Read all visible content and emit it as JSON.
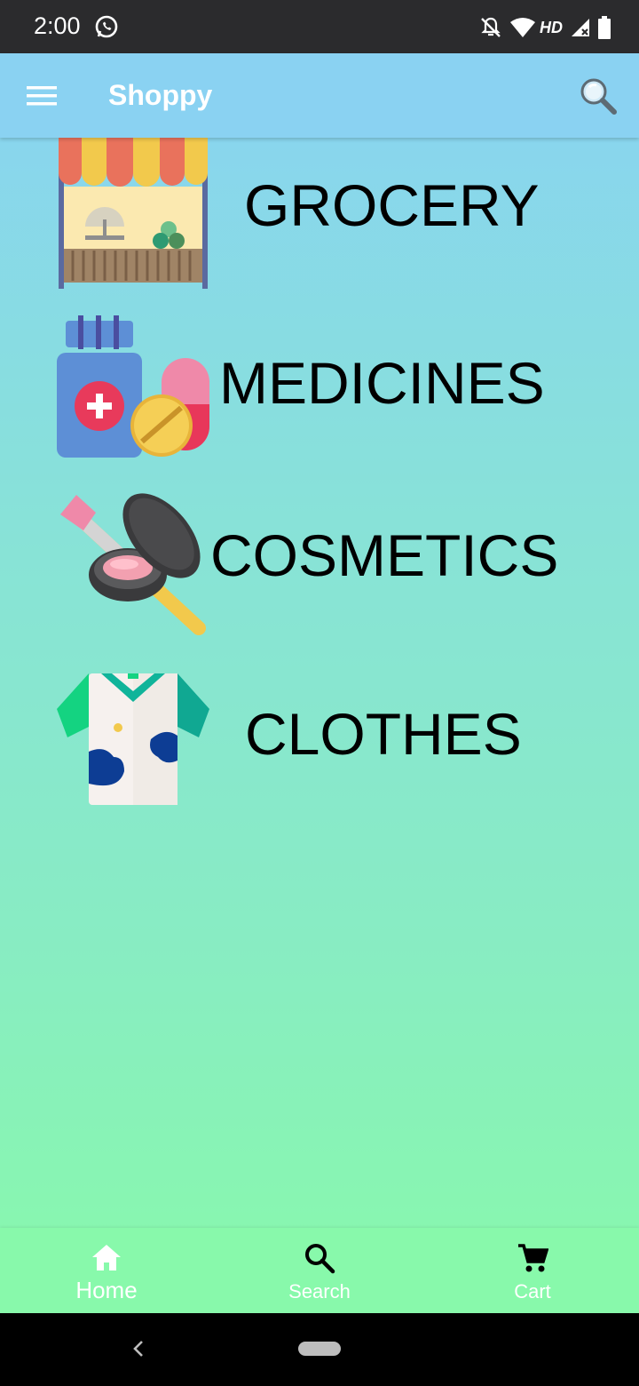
{
  "status_bar": {
    "time": "2:00",
    "icons": [
      "whatsapp-icon",
      "notifications-off-icon",
      "wifi-icon",
      "hd-label",
      "signal-icon",
      "battery-icon"
    ],
    "hd_label": "HD"
  },
  "app_bar": {
    "title": "Shoppy",
    "menu_icon": "hamburger-menu-icon",
    "search_icon": "magnifier-icon"
  },
  "categories": [
    {
      "label": "GROCERY",
      "icon": "market-stall-icon"
    },
    {
      "label": "MEDICINES",
      "icon": "medicine-bottle-pills-icon"
    },
    {
      "label": "COSMETICS",
      "icon": "makeup-compact-brush-icon"
    },
    {
      "label": "CLOTHES",
      "icon": "shirt-icon"
    }
  ],
  "bottom_nav": {
    "items": [
      {
        "label": "Home",
        "icon": "home-icon",
        "selected": true
      },
      {
        "label": "Search",
        "icon": "search-icon",
        "selected": false
      },
      {
        "label": "Cart",
        "icon": "cart-icon",
        "selected": false
      }
    ]
  },
  "colors": {
    "app_bar": "#8ad2f2",
    "gradient_top": "#89d3f2",
    "gradient_bottom": "#88f9ab",
    "status_bar": "#2b2b2d"
  }
}
